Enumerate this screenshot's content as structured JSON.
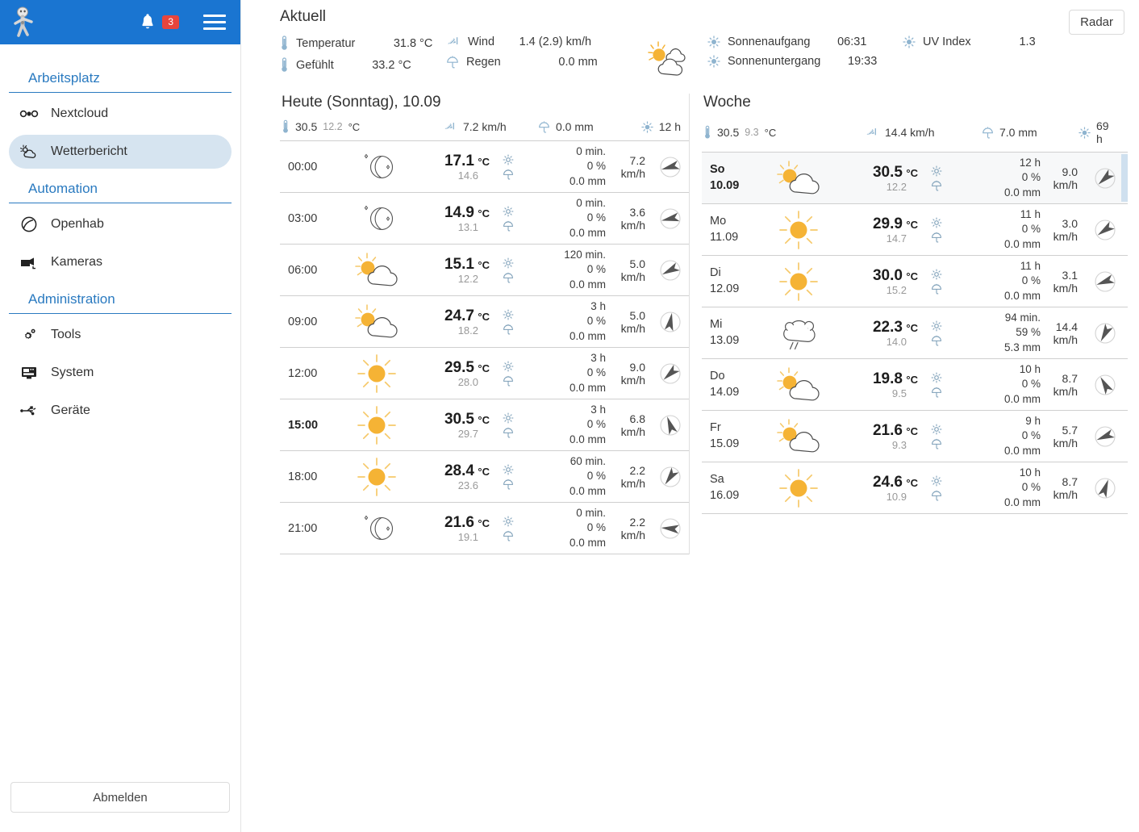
{
  "sidebar": {
    "badge_count": "3",
    "sections": [
      {
        "title": "Arbeitsplatz",
        "items": [
          {
            "label": "Nextcloud",
            "icon": "link-icon",
            "active": false
          },
          {
            "label": "Wetterbericht",
            "icon": "weather-icon",
            "active": true
          }
        ]
      },
      {
        "title": "Automation",
        "items": [
          {
            "label": "Openhab",
            "icon": "openhab-icon",
            "active": false
          },
          {
            "label": "Kameras",
            "icon": "camera-icon",
            "active": false
          }
        ]
      },
      {
        "title": "Administration",
        "items": [
          {
            "label": "Tools",
            "icon": "gear-icon",
            "active": false
          },
          {
            "label": "System",
            "icon": "monitor-icon",
            "active": false
          },
          {
            "label": "Geräte",
            "icon": "usb-icon",
            "active": false
          }
        ]
      }
    ],
    "logout_label": "Abmelden"
  },
  "current": {
    "title": "Aktuell",
    "radar_label": "Radar",
    "icon": "sun-behind-clouds-icon",
    "rows_left": [
      {
        "label": "Temperatur",
        "value": "31.8 °C",
        "icon": "thermometer-icon"
      },
      {
        "label": "Gefühlt",
        "value": "33.2 °C",
        "icon": "thermometer-icon"
      }
    ],
    "rows_mid": [
      {
        "label": "Wind",
        "value": "1.4 (2.9) km/h",
        "icon": "wind-icon"
      },
      {
        "label": "Regen",
        "value": "0.0 mm",
        "icon": "umbrella-icon"
      }
    ],
    "rows_sun": [
      {
        "label": "Sonnenaufgang",
        "value": "06:31",
        "icon": "sun-icon"
      },
      {
        "label": "Sonnenuntergang",
        "value": "19:33",
        "icon": "sun-icon"
      }
    ],
    "rows_uv": [
      {
        "label": "UV Index",
        "value": "1.3",
        "icon": "sun-icon"
      }
    ]
  },
  "today": {
    "title": "Heute (Sonntag), 10.09",
    "summary": {
      "temp_max": "30.5",
      "temp_min": "12.2",
      "temp_unit": "°C",
      "wind": "7.2 km/h",
      "rain": "0.0 mm",
      "sun": "12 h"
    },
    "rows": [
      {
        "time": "00:00",
        "bold": false,
        "icon": "moon-icon",
        "temp": "17.1",
        "unit": "°C",
        "feels": "14.6",
        "sunshine": "0 min.",
        "prob": "0 %",
        "rain": "0.0 mm",
        "wind": "7.2 km/h",
        "dir_deg": 255
      },
      {
        "time": "03:00",
        "bold": false,
        "icon": "moon-icon",
        "temp": "14.9",
        "unit": "°C",
        "feels": "13.1",
        "sunshine": "0 min.",
        "prob": "0 %",
        "rain": "0.0 mm",
        "wind": "3.6 km/h",
        "dir_deg": 258
      },
      {
        "time": "06:00",
        "bold": false,
        "icon": "partly-cloudy-icon",
        "temp": "15.1",
        "unit": "°C",
        "feels": "12.2",
        "sunshine": "120 min.",
        "prob": "0 %",
        "rain": "0.0 mm",
        "wind": "5.0 km/h",
        "dir_deg": 243
      },
      {
        "time": "09:00",
        "bold": false,
        "icon": "partly-cloudy-icon",
        "temp": "24.7",
        "unit": "°C",
        "feels": "18.2",
        "sunshine": "3 h",
        "prob": "0 %",
        "rain": "0.0 mm",
        "wind": "5.0 km/h",
        "dir_deg": 10
      },
      {
        "time": "12:00",
        "bold": false,
        "icon": "sun-icon",
        "temp": "29.5",
        "unit": "°C",
        "feels": "28.0",
        "sunshine": "3 h",
        "prob": "0 %",
        "rain": "0.0 mm",
        "wind": "9.0 km/h",
        "dir_deg": 228
      },
      {
        "time": "15:00",
        "bold": true,
        "icon": "sun-icon",
        "temp": "30.5",
        "unit": "°C",
        "feels": "29.7",
        "sunshine": "3 h",
        "prob": "0 %",
        "rain": "0.0 mm",
        "wind": "6.8 km/h",
        "dir_deg": 340
      },
      {
        "time": "18:00",
        "bold": false,
        "icon": "sun-icon",
        "temp": "28.4",
        "unit": "°C",
        "feels": "23.6",
        "sunshine": "60 min.",
        "prob": "0 %",
        "rain": "0.0 mm",
        "wind": "2.2 km/h",
        "dir_deg": 215
      },
      {
        "time": "21:00",
        "bold": false,
        "icon": "moon-icon",
        "temp": "21.6",
        "unit": "°C",
        "feels": "19.1",
        "sunshine": "0 min.",
        "prob": "0 %",
        "rain": "0.0 mm",
        "wind": "2.2 km/h",
        "dir_deg": 275
      }
    ]
  },
  "week": {
    "title": "Woche",
    "summary": {
      "temp_max": "30.5",
      "temp_min": "9.3",
      "temp_unit": "°C",
      "wind": "14.4 km/h",
      "rain": "7.0 mm",
      "sun": "69 h"
    },
    "rows": [
      {
        "day": "So",
        "date": "10.09",
        "selected": true,
        "icon": "partly-cloudy-icon",
        "temp": "30.5",
        "unit": "°C",
        "feels": "12.2",
        "sunshine": "12 h",
        "prob": "0 %",
        "rain": "0.0 mm",
        "wind": "9.0 km/h",
        "dir_deg": 228
      },
      {
        "day": "Mo",
        "date": "11.09",
        "selected": false,
        "icon": "sun-icon",
        "temp": "29.9",
        "unit": "°C",
        "feels": "14.7",
        "sunshine": "11 h",
        "prob": "0 %",
        "rain": "0.0 mm",
        "wind": "3.0 km/h",
        "dir_deg": 235
      },
      {
        "day": "Di",
        "date": "12.09",
        "selected": false,
        "icon": "sun-icon",
        "temp": "30.0",
        "unit": "°C",
        "feels": "15.2",
        "sunshine": "11 h",
        "prob": "0 %",
        "rain": "0.0 mm",
        "wind": "3.1 km/h",
        "dir_deg": 250
      },
      {
        "day": "Mi",
        "date": "13.09",
        "selected": false,
        "icon": "rain-cloud-icon",
        "temp": "22.3",
        "unit": "°C",
        "feels": "14.0",
        "sunshine": "94 min.",
        "prob": "59 %",
        "rain": "5.3 mm",
        "wind": "14.4 km/h",
        "dir_deg": 208
      },
      {
        "day": "Do",
        "date": "14.09",
        "selected": false,
        "icon": "partly-cloudy-icon",
        "temp": "19.8",
        "unit": "°C",
        "feels": "9.5",
        "sunshine": "10 h",
        "prob": "0 %",
        "rain": "0.0 mm",
        "wind": "8.7 km/h",
        "dir_deg": 330
      },
      {
        "day": "Fr",
        "date": "15.09",
        "selected": false,
        "icon": "partly-cloudy-icon",
        "temp": "21.6",
        "unit": "°C",
        "feels": "9.3",
        "sunshine": "9 h",
        "prob": "0 %",
        "rain": "0.0 mm",
        "wind": "5.7 km/h",
        "dir_deg": 248
      },
      {
        "day": "Sa",
        "date": "16.09",
        "selected": false,
        "icon": "sun-icon",
        "temp": "24.6",
        "unit": "°C",
        "feels": "10.9",
        "sunshine": "10 h",
        "prob": "0 %",
        "rain": "0.0 mm",
        "wind": "8.7 km/h",
        "dir_deg": 20
      }
    ]
  },
  "colors": {
    "header_blue": "#1a75d1",
    "accent_blue": "#2a7ac0",
    "badge_red": "#e8453c",
    "sun_orange": "#f5b335",
    "icon_blue": "#8fb4cf",
    "active_item": "#d6e4f0"
  }
}
